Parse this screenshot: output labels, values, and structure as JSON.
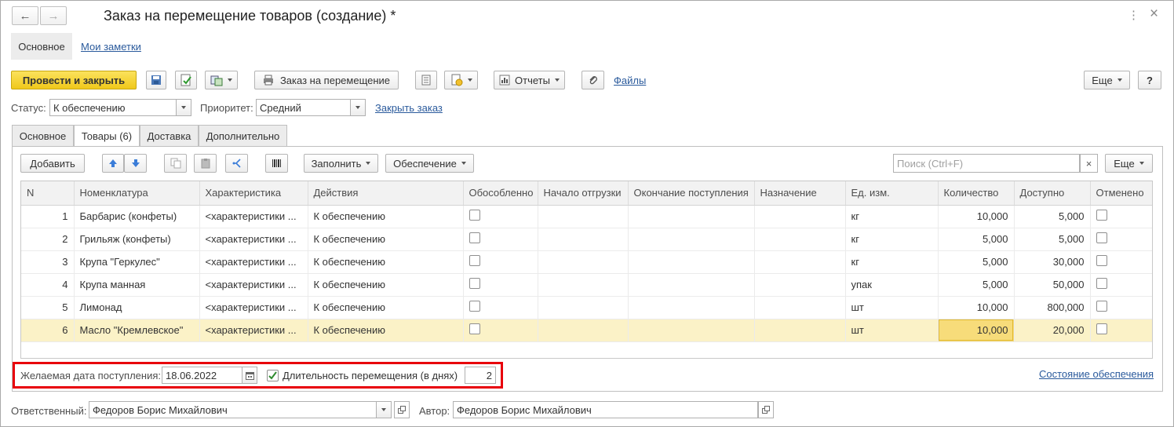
{
  "window": {
    "title": "Заказ на перемещение товаров (создание) *",
    "back_icon": "←",
    "forward_icon": "→",
    "more_icon": "⋮",
    "close_icon": "×"
  },
  "top_tabs": {
    "main": "Основное",
    "notes": "Мои заметки"
  },
  "toolbar": {
    "post_close": "Провести и закрыть",
    "print_order": "Заказ на перемещение",
    "reports": "Отчеты",
    "files": "Файлы",
    "more": "Еще",
    "help": "?"
  },
  "status_row": {
    "status_label": "Статус:",
    "status_value": "К обеспечению",
    "priority_label": "Приоритет:",
    "priority_value": "Средний",
    "close_order": "Закрыть заказ"
  },
  "tabs": [
    {
      "label": "Основное"
    },
    {
      "label": "Товары (6)"
    },
    {
      "label": "Доставка"
    },
    {
      "label": "Дополнительно"
    }
  ],
  "table_toolbar": {
    "add": "Добавить",
    "fill": "Заполнить",
    "supply": "Обеспечение",
    "search_placeholder": "Поиск (Ctrl+F)",
    "search_clear": "×",
    "more": "Еще"
  },
  "table": {
    "columns": [
      "N",
      "Номенклатура",
      "Характеристика",
      "Действия",
      "Обособленно",
      "Начало отгрузки",
      "Окончание поступления",
      "Назначение",
      "Ед. изм.",
      "Количество",
      "Доступно",
      "Отменено"
    ],
    "rows": [
      {
        "n": "1",
        "name": "Барбарис (конфеты)",
        "char": "<характеристики ...",
        "action": "К обеспечению",
        "unit": "кг",
        "qty": "10,000",
        "avail": "5,000"
      },
      {
        "n": "2",
        "name": "Грильяж (конфеты)",
        "char": "<характеристики ...",
        "action": "К обеспечению",
        "unit": "кг",
        "qty": "5,000",
        "avail": "5,000"
      },
      {
        "n": "3",
        "name": "Крупа \"Геркулес\"",
        "char": "<характеристики ...",
        "action": "К обеспечению",
        "unit": "кг",
        "qty": "5,000",
        "avail": "30,000"
      },
      {
        "n": "4",
        "name": "Крупа манная",
        "char": "<характеристики ...",
        "action": "К обеспечению",
        "unit": "упак",
        "qty": "5,000",
        "avail": "50,000"
      },
      {
        "n": "5",
        "name": "Лимонад",
        "char": "<характеристики ...",
        "action": "К обеспечению",
        "unit": "шт",
        "qty": "10,000",
        "avail": "800,000"
      },
      {
        "n": "6",
        "name": "Масло \"Кремлевское\"",
        "char": "<характеристики ...",
        "action": "К обеспечению",
        "unit": "шт",
        "qty": "10,000",
        "avail": "20,000"
      }
    ]
  },
  "bottom": {
    "desired_date_label": "Желаемая дата поступления:",
    "desired_date_value": "18.06.2022",
    "duration_label": "Длительность перемещения (в днях)",
    "duration_value": "2",
    "supply_status": "Состояние обеспечения"
  },
  "footer": {
    "responsible_label": "Ответственный:",
    "responsible_value": "Федоров Борис Михайлович",
    "author_label": "Автор:",
    "author_value": "Федоров Борис Михайлович"
  },
  "colors": {
    "accent_yellow": "#f5d12a",
    "highlight_red": "#e8000b",
    "link_blue": "#2a5a9c",
    "selected_row": "#fbf2c7"
  }
}
